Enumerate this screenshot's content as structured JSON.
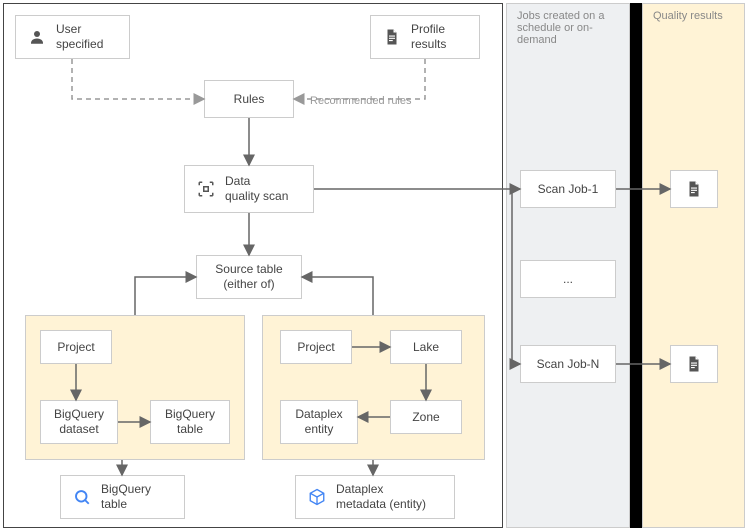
{
  "nodes": {
    "user_specified": "User\nspecified",
    "profile_results": "Profile\nresults",
    "rules": "Rules",
    "data_quality_scan": "Data\nquality scan",
    "source_table": "Source table\n(either of)",
    "bq_project": "Project",
    "bq_dataset": "BigQuery\ndataset",
    "bq_table": "BigQuery\ntable",
    "bq_table_out": "BigQuery\ntable",
    "dp_project": "Project",
    "dp_lake": "Lake",
    "dp_zone": "Zone",
    "dp_entity": "Dataplex\nentity",
    "dp_metadata_out": "Dataplex\nmetadata (entity)",
    "scan_job_1": "Scan Job-1",
    "scan_job_ellipsis": "...",
    "scan_job_n": "Scan Job-N"
  },
  "regions": {
    "jobs_title": "Jobs created on a\nschedule or on-demand",
    "quality_title": "Quality results"
  },
  "edges": {
    "recommended_rules": "Recommended rules"
  },
  "icons": {
    "user": "user-icon",
    "document": "document-icon",
    "scan": "scan-icon",
    "bigquery": "bigquery-icon",
    "dataplex": "dataplex-icon"
  }
}
